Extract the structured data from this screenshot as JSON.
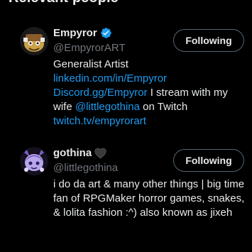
{
  "section": {
    "title": "Relevant people"
  },
  "colors": {
    "background": "#000000",
    "text": "#e7e9ea",
    "muted": "#71767b",
    "link": "#1d9bf0",
    "verified": "#1d9bf0",
    "button_border": "#536471"
  },
  "people": [
    {
      "name": "Empyror",
      "handle": "@EmpyrorART",
      "badge_icon": "verified-badge-icon",
      "follow_label": "Following",
      "bio": {
        "line1": "Generalist Artist",
        "link1": "linkedin.com/in/Empyror",
        "link2": "Discord.gg/Empyror",
        "text2": " I stream with my",
        "text3": "wife ",
        "mention": "@littlegothina",
        "text4": " on Twitch",
        "link3": "twitch.tv/empyrorart"
      }
    },
    {
      "name": "gothina",
      "handle": "@littlegothina",
      "badge_icon": "black-heart-icon",
      "follow_label": "Following",
      "bio": {
        "text": "i do da art & many other things | big time fan of RPGMaker horror games, snakes, & lolita fashion :^) also known as jixeh"
      }
    }
  ]
}
